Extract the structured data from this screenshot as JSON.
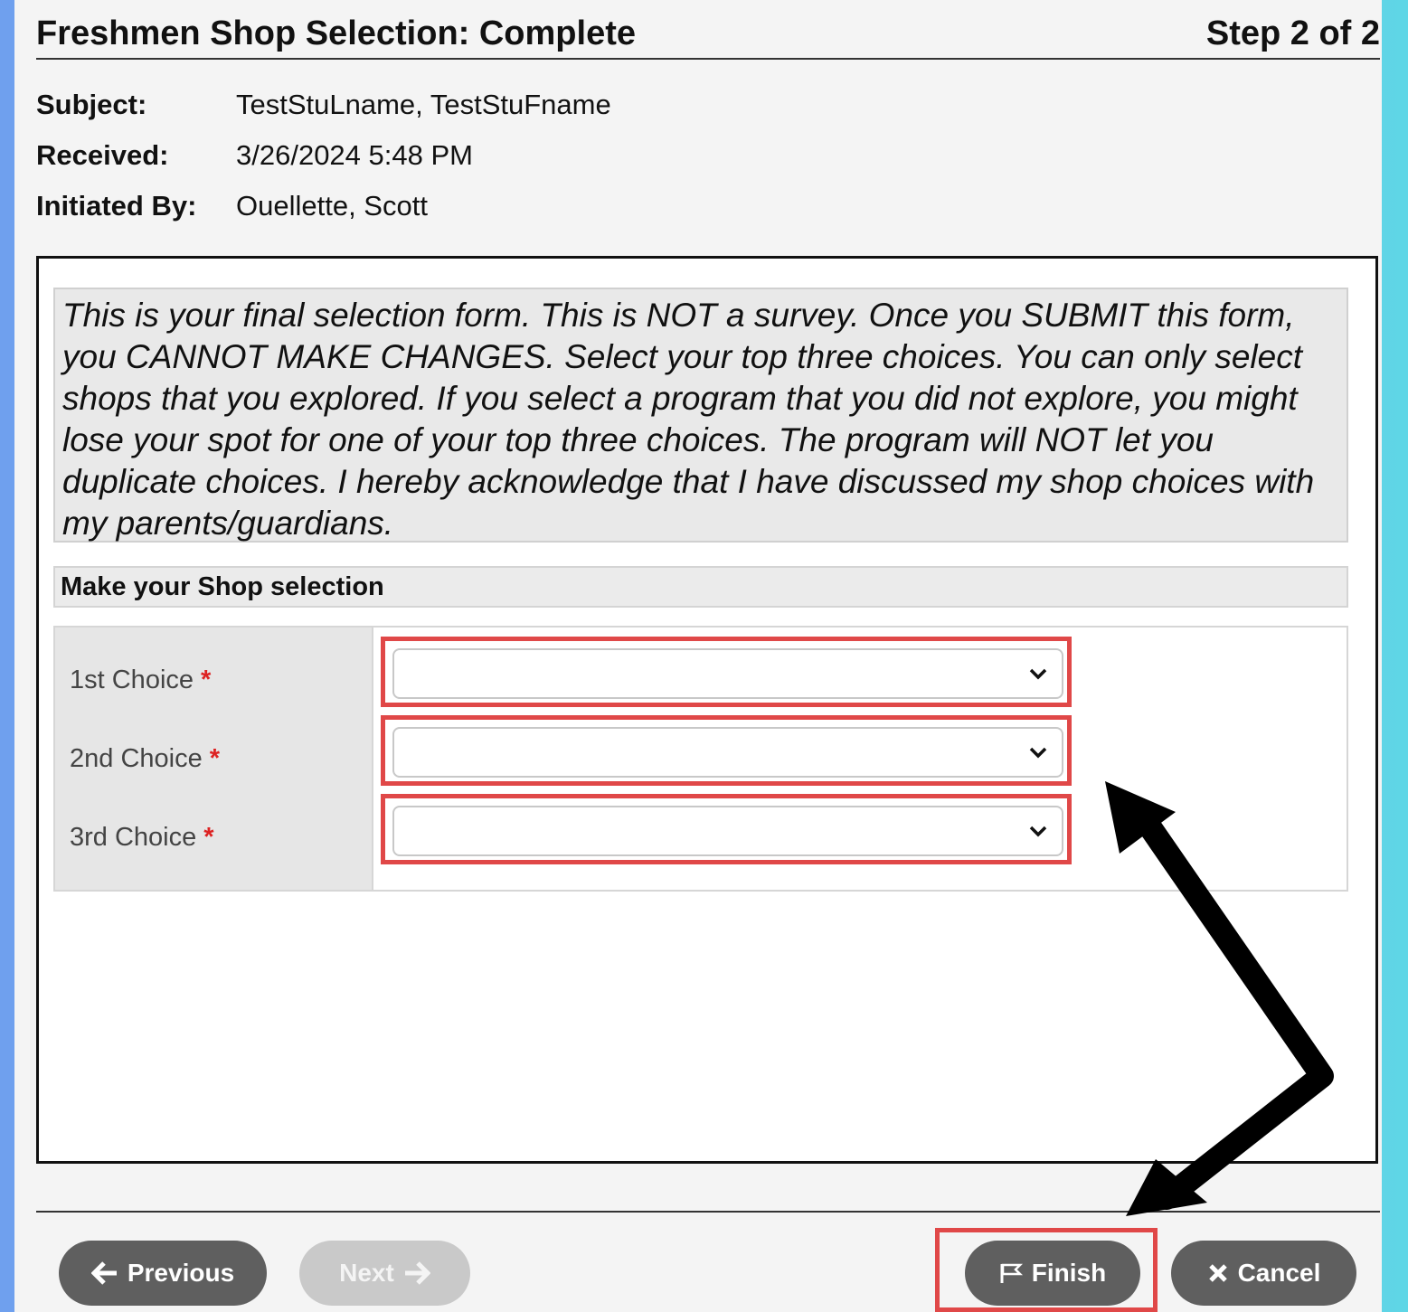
{
  "header": {
    "title": "Freshmen Shop Selection: Complete",
    "step": "Step 2 of 2"
  },
  "meta": {
    "subject_label": "Subject:",
    "subject_value": "TestStuLname, TestStuFname",
    "received_label": "Received:",
    "received_value": "3/26/2024 5:48 PM",
    "initiated_label": "Initiated By:",
    "initiated_value": "Ouellette, Scott"
  },
  "notice": "This is your final selection form. This is NOT a survey. Once you SUBMIT this form, you CANNOT MAKE CHANGES. Select your top three choices. You can only select shops that you explored. If you select a program that you did not explore, you might lose your spot for one of your top three choices. The program will NOT let you duplicate choices. I hereby acknowledge that I have discussed my shop choices with my parents/guardians.",
  "section_title": "Make your Shop selection",
  "choices": [
    {
      "label": "1st Choice",
      "required": "*",
      "value": ""
    },
    {
      "label": "2nd Choice",
      "required": "*",
      "value": ""
    },
    {
      "label": "3rd Choice",
      "required": "*",
      "value": ""
    }
  ],
  "buttons": {
    "previous": "Previous",
    "next": "Next",
    "finish": "Finish",
    "cancel": "Cancel"
  },
  "colors": {
    "highlight": "#e04848",
    "button": "#5f5f5f",
    "button_disabled": "#c9c9c9",
    "required": "#d22222"
  },
  "icons": {
    "previous": "arrow-left-icon",
    "next": "arrow-right-icon",
    "finish": "flag-icon",
    "cancel": "x-icon",
    "select": "chevron-down-icon"
  }
}
